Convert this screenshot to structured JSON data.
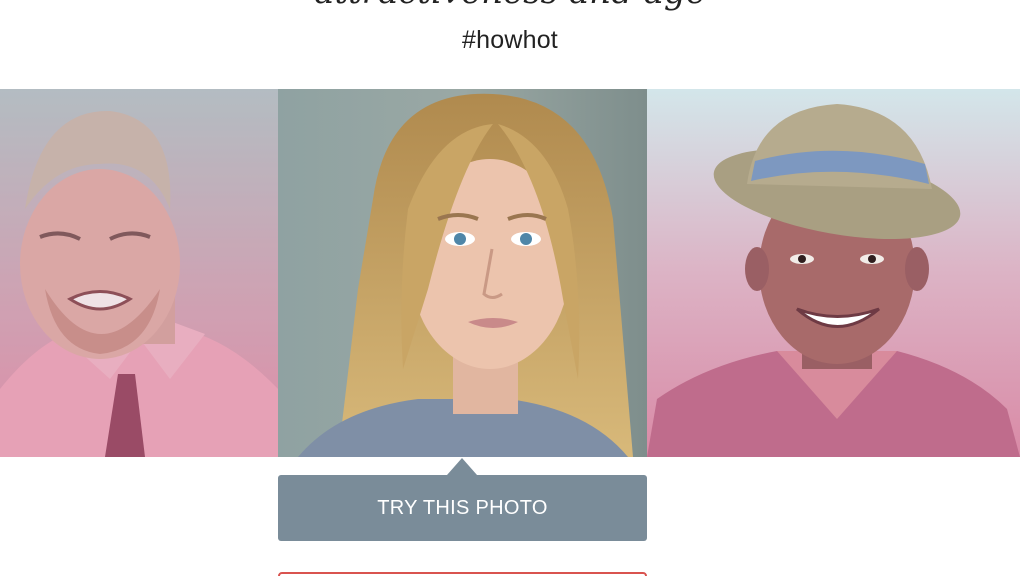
{
  "header": {
    "headline": "attractiveness and age",
    "hashtag": "#howhot"
  },
  "photos": [
    {
      "icon": "man-grimacing-photo"
    },
    {
      "icon": "woman-blonde-portrait-photo"
    },
    {
      "icon": "man-smiling-hat-photo"
    }
  ],
  "actions": {
    "try_label": "TRY THIS PHOTO"
  },
  "colors": {
    "button": "#7a8c99",
    "overlay_top": "#b9d3d8",
    "overlay_bottom": "#d97c9a",
    "upload_border": "#d9534f"
  }
}
